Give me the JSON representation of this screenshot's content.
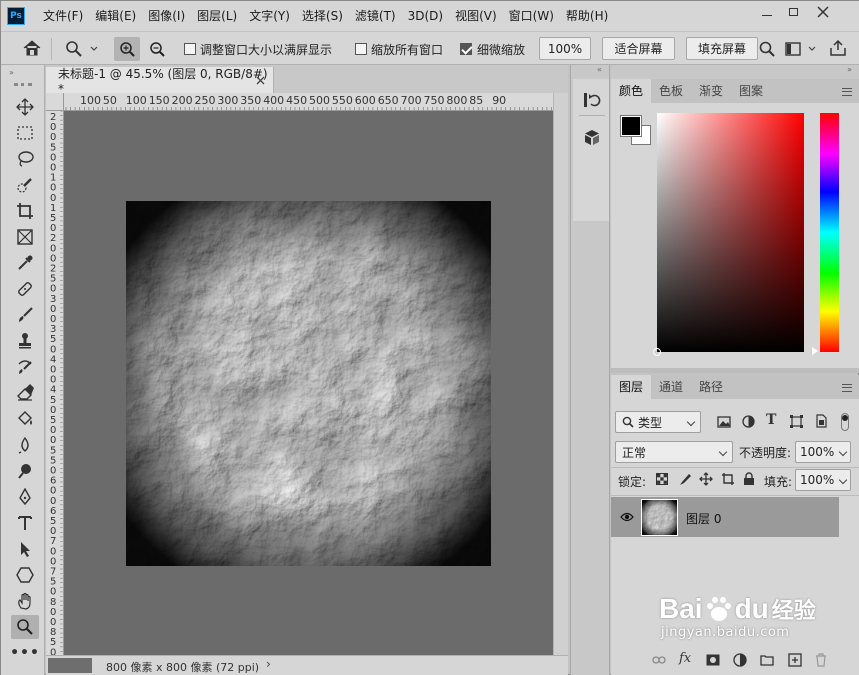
{
  "app": {
    "logo": "Ps"
  },
  "menu": [
    "文件(F)",
    "编辑(E)",
    "图像(I)",
    "图层(L)",
    "文字(Y)",
    "选择(S)",
    "滤镜(T)",
    "3D(D)",
    "视图(V)",
    "窗口(W)",
    "帮助(H)"
  ],
  "options": {
    "resize_windows_label": "调整窗口大小以满屏显示",
    "resize_windows_checked": false,
    "zoom_all_label": "缩放所有窗口",
    "zoom_all_checked": false,
    "scrubby_zoom_label": "细微缩放",
    "scrubby_zoom_checked": true,
    "zoom_value": "100%",
    "fit_screen_label": "适合屏幕",
    "fill_screen_label": "填充屏幕"
  },
  "document": {
    "tab_title": "未标题-1 @ 45.5% (图层 0, RGB/8#) *",
    "ruler_top": [
      "100",
      "50",
      "100",
      "150",
      "200",
      "250",
      "300",
      "350",
      "400",
      "450",
      "500",
      "550",
      "600",
      "650",
      "700",
      "750",
      "800",
      "85",
      "90"
    ],
    "ruler_left": [
      "2",
      "0",
      "0",
      "5",
      "0",
      "0",
      "1",
      "0",
      "0",
      "1",
      "5",
      "0",
      "2",
      "0",
      "0",
      "2",
      "5",
      "0",
      "3",
      "0",
      "0",
      "3",
      "5",
      "0",
      "4",
      "0",
      "0",
      "4",
      "5",
      "0",
      "5",
      "0",
      "0",
      "5",
      "5",
      "0",
      "6",
      "0",
      "0",
      "6",
      "5",
      "0",
      "7",
      "0",
      "0",
      "7",
      "5",
      "0",
      "8",
      "0",
      "0",
      "8",
      "5",
      "0"
    ],
    "status": "800 像素 x 800 像素 (72 ppi)"
  },
  "color_panel": {
    "tabs": [
      "颜色",
      "色板",
      "渐变",
      "图案"
    ],
    "active_tab": "颜色",
    "foreground": "#000000",
    "background": "#ffffff",
    "hue_color": "#ff0000"
  },
  "layers_panel": {
    "tabs": [
      "图层",
      "通道",
      "路径"
    ],
    "active_tab": "图层",
    "filter_kind": "类型",
    "blend_mode": "正常",
    "opacity_label": "不透明度:",
    "opacity_value": "100%",
    "lock_label": "锁定:",
    "fill_label": "填充:",
    "fill_value": "100%",
    "layers": [
      {
        "name": "图层 0",
        "visible": true
      }
    ],
    "footer_icons": [
      "link-icon",
      "fx-icon",
      "mask-icon",
      "adjustment-icon",
      "folder-icon",
      "new-layer-icon",
      "trash-icon"
    ],
    "fx_label": "fx"
  },
  "watermark": {
    "brand": "Bai",
    "brand2": "du",
    "cn": "经验",
    "url": "jingyan.baidu.com"
  }
}
